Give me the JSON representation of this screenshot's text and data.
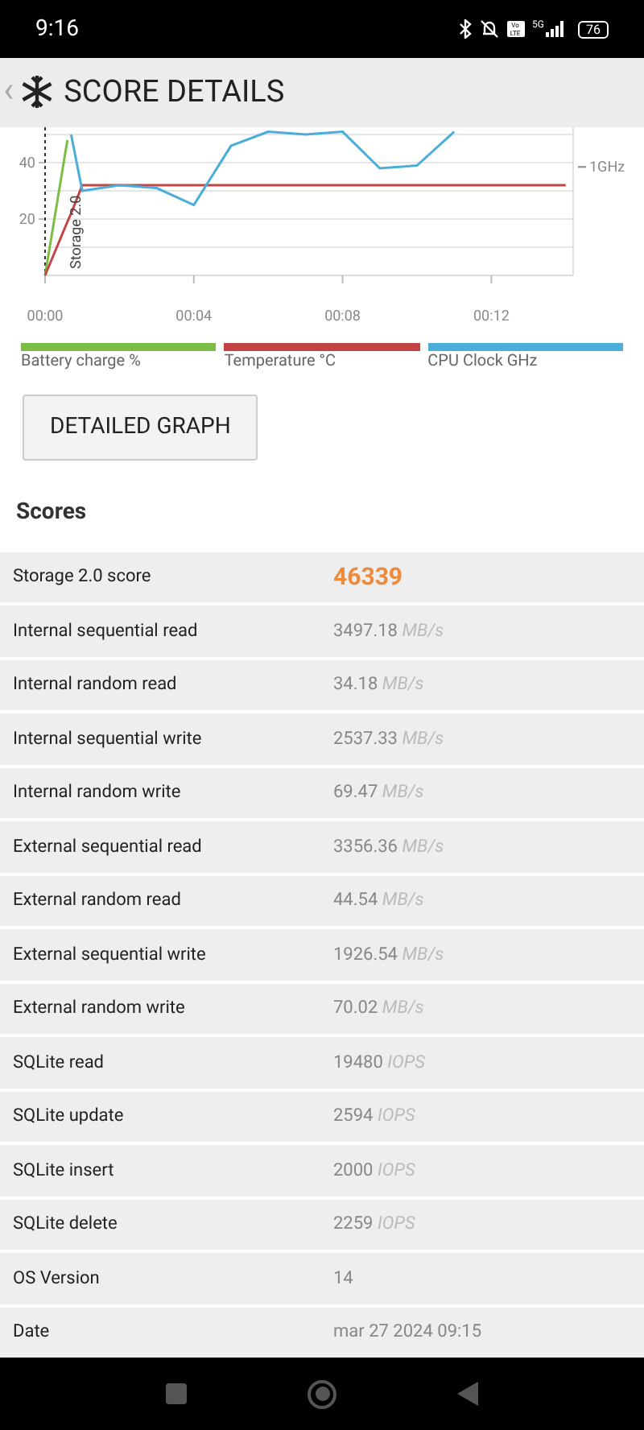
{
  "status_bar": {
    "time": "9:16",
    "volte": "Vo LTE",
    "network": "5G",
    "battery": "76"
  },
  "header": {
    "back": "‹",
    "title": "SCORE DETAILS"
  },
  "chart": {
    "right_axis_label": "1GHz",
    "marker_label": "Storage 2.0",
    "chart_data": {
      "type": "line",
      "x": [
        0,
        0.6,
        0.7,
        1,
        2,
        3,
        4,
        5,
        6,
        7,
        8,
        9,
        10,
        11,
        14
      ],
      "xlim": [
        0,
        14.2
      ],
      "ylim": [
        0,
        52.6
      ],
      "xticks": [
        {
          "value": 0,
          "label": "00:00"
        },
        {
          "value": 4,
          "label": "00:04"
        },
        {
          "value": 8,
          "label": "00:08"
        },
        {
          "value": 12,
          "label": "00:12"
        }
      ],
      "yticks": [
        20,
        40
      ],
      "series": [
        {
          "name": "Battery charge %",
          "color": "#7cbd45",
          "values": [
            0,
            48,
            null,
            null,
            null,
            null,
            null,
            null,
            null,
            null,
            null,
            null,
            null,
            null,
            null
          ]
        },
        {
          "name": "Temperature °C",
          "color": "#c24444",
          "values": [
            0,
            19,
            22,
            32,
            32,
            32,
            32,
            32,
            32,
            32,
            32,
            32,
            32,
            32,
            32
          ]
        },
        {
          "name": "CPU Clock GHz",
          "color": "#4aaed9",
          "values": [
            null,
            null,
            50,
            30,
            32,
            31,
            25,
            46,
            51,
            50,
            51,
            38,
            39,
            51,
            null
          ]
        }
      ]
    }
  },
  "button": "DETAILED GRAPH",
  "section_title": "Scores",
  "rows": [
    {
      "kind": "score",
      "label": "Storage 2.0 score",
      "value": "46339"
    },
    {
      "kind": "measure",
      "label": "Internal sequential read",
      "value": "3497.18",
      "unit": "MB/s"
    },
    {
      "kind": "measure",
      "label": "Internal random read",
      "value": "34.18",
      "unit": "MB/s"
    },
    {
      "kind": "measure",
      "label": "Internal sequential write",
      "value": "2537.33",
      "unit": "MB/s"
    },
    {
      "kind": "measure",
      "label": "Internal random write",
      "value": "69.47",
      "unit": "MB/s"
    },
    {
      "kind": "measure",
      "label": "External sequential read",
      "value": "3356.36",
      "unit": "MB/s"
    },
    {
      "kind": "measure",
      "label": "External random read",
      "value": "44.54",
      "unit": "MB/s"
    },
    {
      "kind": "measure",
      "label": "External sequential write",
      "value": "1926.54",
      "unit": "MB/s"
    },
    {
      "kind": "measure",
      "label": "External random write",
      "value": "70.02",
      "unit": "MB/s"
    },
    {
      "kind": "measure",
      "label": "SQLite read",
      "value": "19480",
      "unit": "IOPS"
    },
    {
      "kind": "measure",
      "label": "SQLite update",
      "value": "2594",
      "unit": "IOPS"
    },
    {
      "kind": "measure",
      "label": "SQLite insert",
      "value": "2000",
      "unit": "IOPS"
    },
    {
      "kind": "measure",
      "label": "SQLite delete",
      "value": "2259",
      "unit": "IOPS"
    },
    {
      "kind": "measure",
      "label": "OS Version",
      "value": "14"
    },
    {
      "kind": "measure",
      "label": "Date",
      "value": "mar 27 2024 09:15"
    }
  ]
}
